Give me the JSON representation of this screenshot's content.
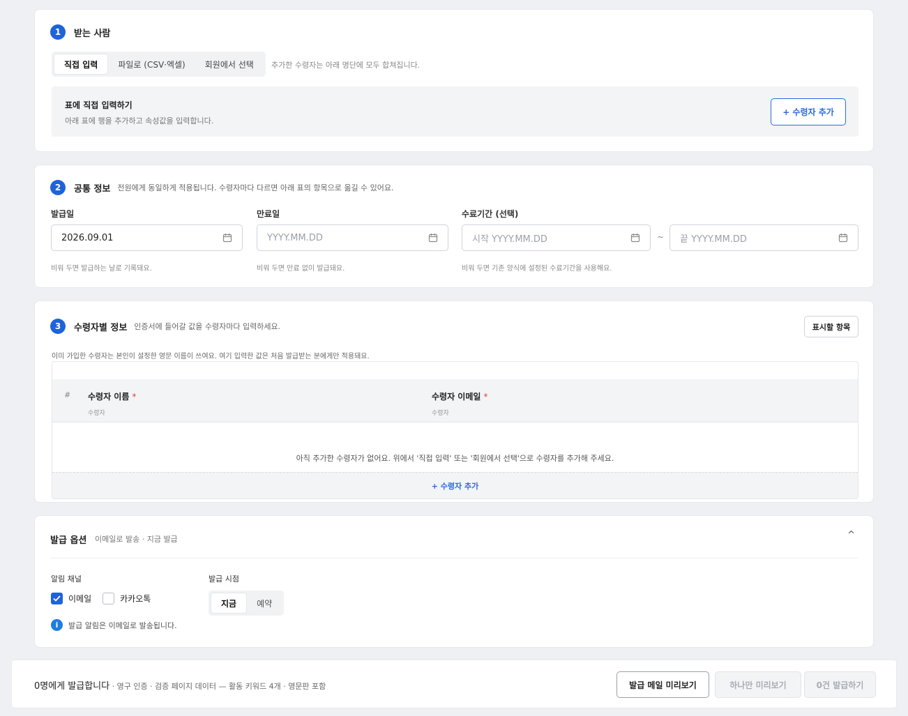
{
  "section1": {
    "num": "1",
    "title": "받는 사람",
    "tabs": [
      {
        "label": "직접 입력"
      },
      {
        "label": "파일로 (CSV·엑셀)"
      },
      {
        "label": "회원에서 선택"
      }
    ],
    "tabs_note": "추가한 수령자는 아래 명단에 모두 합쳐집니다.",
    "inner_title": "표에 직접 입력하기",
    "inner_desc": "아래 표에 행을 추가하고 속성값을 입력합니다.",
    "add_button": "+ 수령자 추가"
  },
  "section2": {
    "num": "2",
    "title": "공통 정보",
    "desc": "전원에게 동일하게 적용됩니다. 수령자마다 다르면 아래 표의 항목으로 옮길 수 있어요.",
    "issue_date": {
      "label": "발급일",
      "value": "2026.09.01",
      "hint": "비워 두면 발급하는 날로 기록돼요."
    },
    "expiry_date": {
      "label": "만료일",
      "placeholder": "YYYY.MM.DD",
      "hint": "비워 두면 만료 없이 발급돼요."
    },
    "period": {
      "label": "수료기간 (선택)",
      "start_placeholder": "시작 YYYY.MM.DD",
      "end_placeholder": "끝 YYYY.MM.DD",
      "separator": "~",
      "hint": "비워 두면 기존 양식에 설정된 수료기간을 사용해요."
    }
  },
  "section3": {
    "num": "3",
    "title": "수령자별 정보",
    "desc": "인증서에 들어갈 값을 수령자마다 입력하세요.",
    "display_button": "표시할 항목",
    "notice": "이미 가입한 수령자는 본인이 설정한 영문 이름이 쓰여요. 여기 입력한 값은 처음 발급받는 분에게만 적용돼요.",
    "table": {
      "hash": "#",
      "columns": [
        {
          "name": "수령자 이름",
          "required": "*",
          "sub": "수령자"
        },
        {
          "name": "수령자 이메일",
          "required": "*",
          "sub": "수령자"
        }
      ],
      "empty": "아직 추가한 수령자가 없어요. 위에서 '직접 입력' 또는 '회원에서 선택'으로 수령자를 추가해 주세요.",
      "add_row": "+ 수령자 추가"
    }
  },
  "options": {
    "title": "발급 옵션",
    "summary": "이메일로 발송 · 지금 발급",
    "caret": "^",
    "channel_label": "알림 채널",
    "channels": [
      {
        "label": "이메일",
        "checked": true
      },
      {
        "label": "카카오톡",
        "checked": false
      }
    ],
    "timing_label": "발급 시점",
    "timing": [
      {
        "label": "지금"
      },
      {
        "label": "예약"
      }
    ],
    "info_icon": "i",
    "info": "발급 알림은 이메일로 발송됩니다."
  },
  "footer": {
    "count_text": "0명에게 발급합니다",
    "meta": " · 영구 인증 · 검증 페이지 데이터 — 활동 키워드 4개 · 영문판 포함",
    "preview_mail": "발급 메일 미리보기",
    "preview_one": "하나만 미리보기",
    "issue": "0건 발급하기"
  },
  "colors": {
    "accent": "#1f63d8",
    "required": "#e0413a",
    "background": "#eef0f3"
  }
}
